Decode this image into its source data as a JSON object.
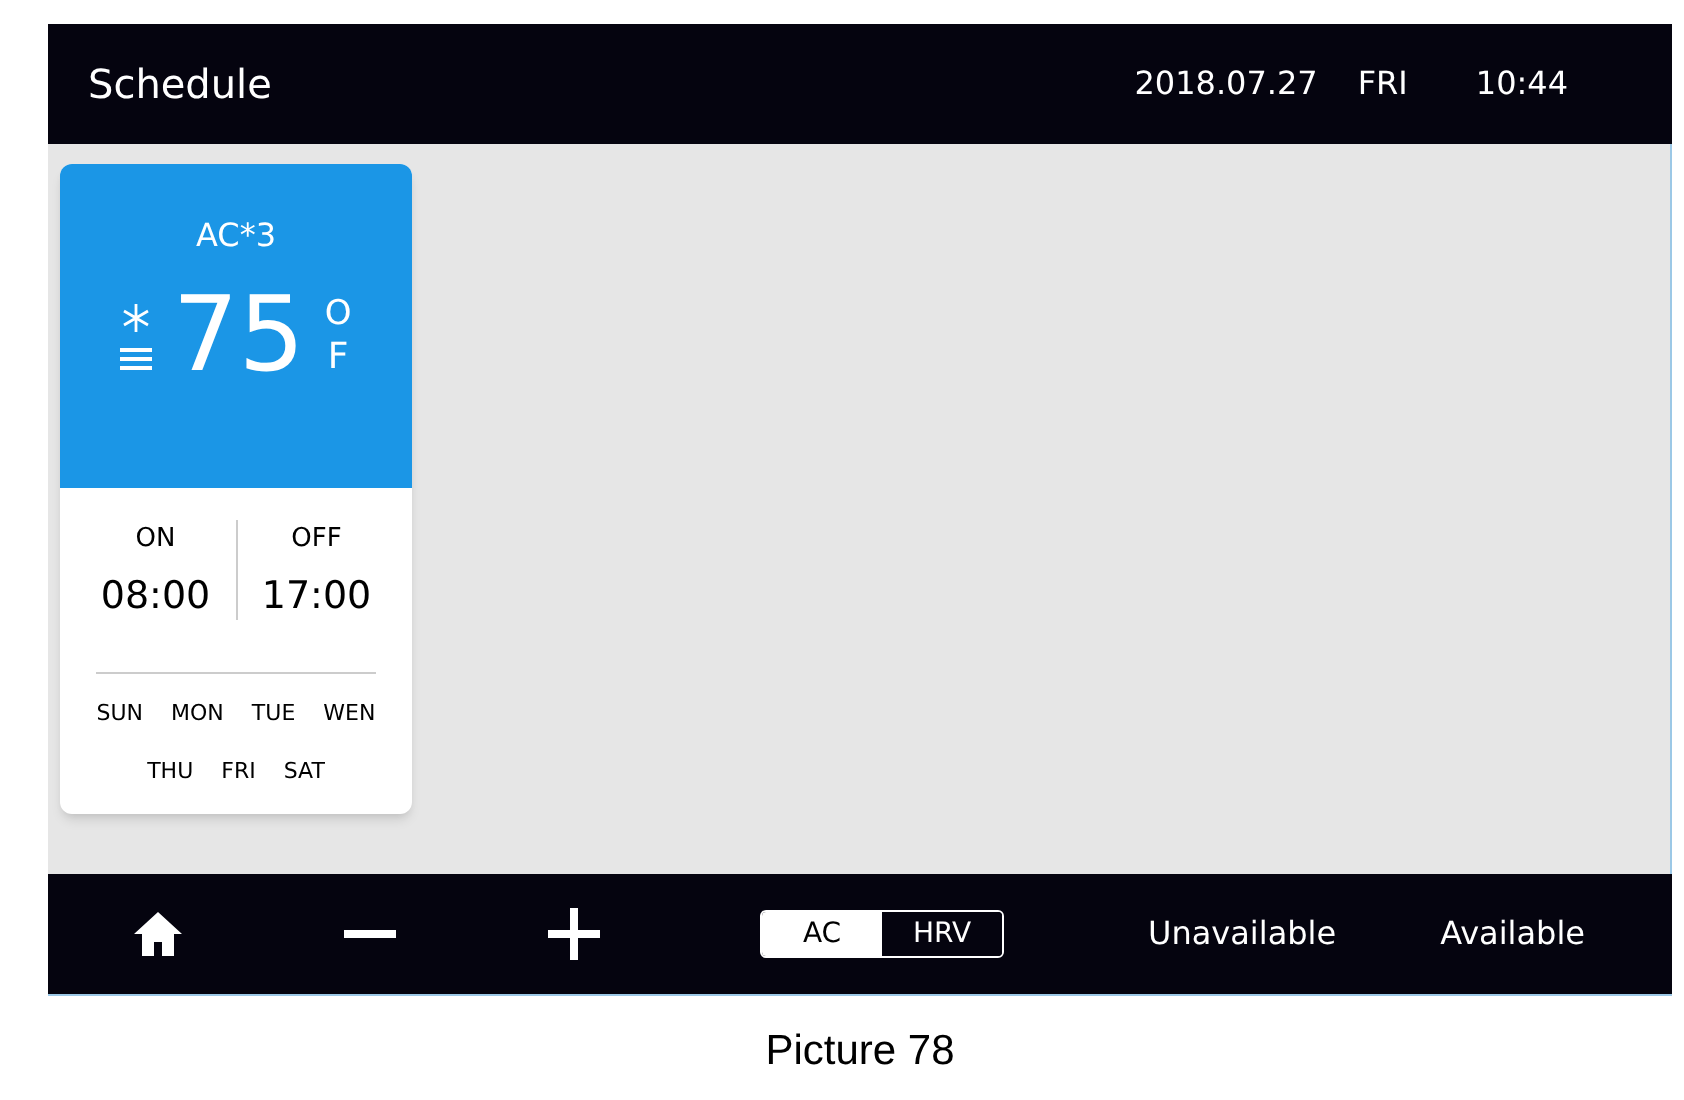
{
  "header": {
    "title": "Schedule",
    "date": "2018.07.27",
    "weekday": "FRI",
    "time": "10:44"
  },
  "card": {
    "name": "AC*3",
    "temperature": "75",
    "unit_mark": "O",
    "unit": "F",
    "on_label": "ON",
    "on_time": "08:00",
    "off_label": "OFF",
    "off_time": "17:00",
    "days": [
      "SUN",
      "MON",
      "TUE",
      "WEN",
      "THU",
      "FRI",
      "SAT"
    ]
  },
  "footer": {
    "toggle": [
      {
        "label": "AC",
        "selected": true
      },
      {
        "label": "HRV",
        "selected": false
      }
    ],
    "unavailable": "Unavailable",
    "available": "Available"
  },
  "caption": "Picture 78"
}
